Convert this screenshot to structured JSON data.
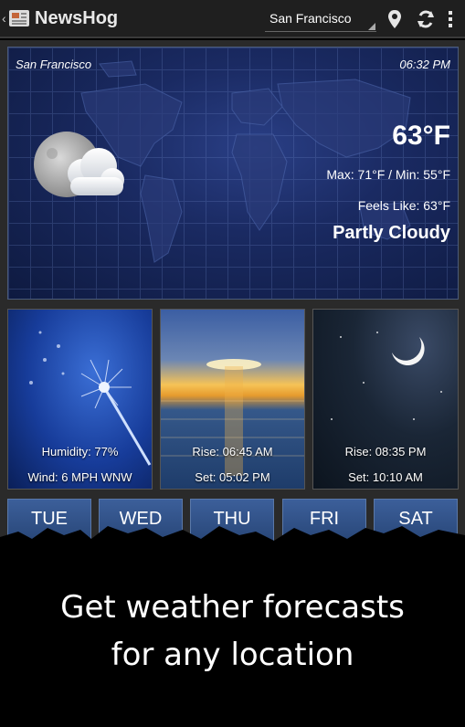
{
  "actionbar": {
    "title": "NewsHog",
    "location_selected": "San Francisco"
  },
  "current": {
    "city": "San Francisco",
    "time": "06:32 PM",
    "temperature": "63°F",
    "max_min": "Max: 71°F / Min: 55°F",
    "feels_like": "Feels Like: 63°F",
    "condition": "Partly Cloudy"
  },
  "tiles": {
    "wind": {
      "humidity": "Humidity: 77%",
      "wind": "Wind: 6 MPH WNW"
    },
    "sun": {
      "rise": "Rise: 06:45 AM",
      "set": "Set: 05:02 PM"
    },
    "moon": {
      "rise": "Rise: 08:35 PM",
      "set": "Set: 10:10 AM"
    }
  },
  "forecast_days": [
    "TUE",
    "WED",
    "THU",
    "FRI",
    "SAT"
  ],
  "caption": {
    "line1": "Get weather forecasts",
    "line2": "for any location"
  },
  "icons": [
    "back-chevron-icon",
    "newspaper-icon",
    "location-pin-icon",
    "refresh-icon",
    "overflow-menu-icon",
    "moon-cloud-icon"
  ]
}
